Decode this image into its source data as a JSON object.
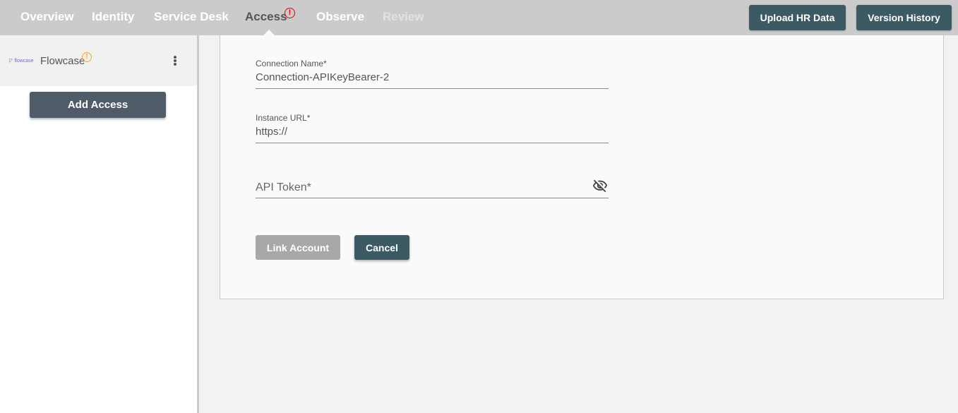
{
  "nav": {
    "tabs": [
      {
        "label": "Overview",
        "state": "normal"
      },
      {
        "label": "Identity",
        "state": "normal"
      },
      {
        "label": "Service Desk",
        "state": "normal"
      },
      {
        "label": "Access",
        "state": "active",
        "badge": "!"
      },
      {
        "label": "Observe",
        "state": "normal"
      },
      {
        "label": "Review",
        "state": "disabled"
      }
    ],
    "buttons": {
      "upload_hr_data": "Upload HR Data",
      "version_history": "Version History"
    }
  },
  "sidebar": {
    "integration": {
      "logo_text": "flowcase",
      "name": "Flowcase",
      "warning_badge": "!"
    },
    "add_access_label": "Add Access"
  },
  "form": {
    "connection_name": {
      "label": "Connection Name*",
      "value": "Connection-APIKeyBearer-2"
    },
    "instance_url": {
      "label": "Instance URL*",
      "value": "https://"
    },
    "api_token": {
      "placeholder": "API Token*",
      "value": ""
    },
    "link_account_label": "Link Account",
    "cancel_label": "Cancel"
  },
  "colors": {
    "primary_button": "#3c5a64",
    "disabled_button": "#a8a8a8",
    "alert_red": "#e00000",
    "warning_orange": "#f5a623"
  }
}
